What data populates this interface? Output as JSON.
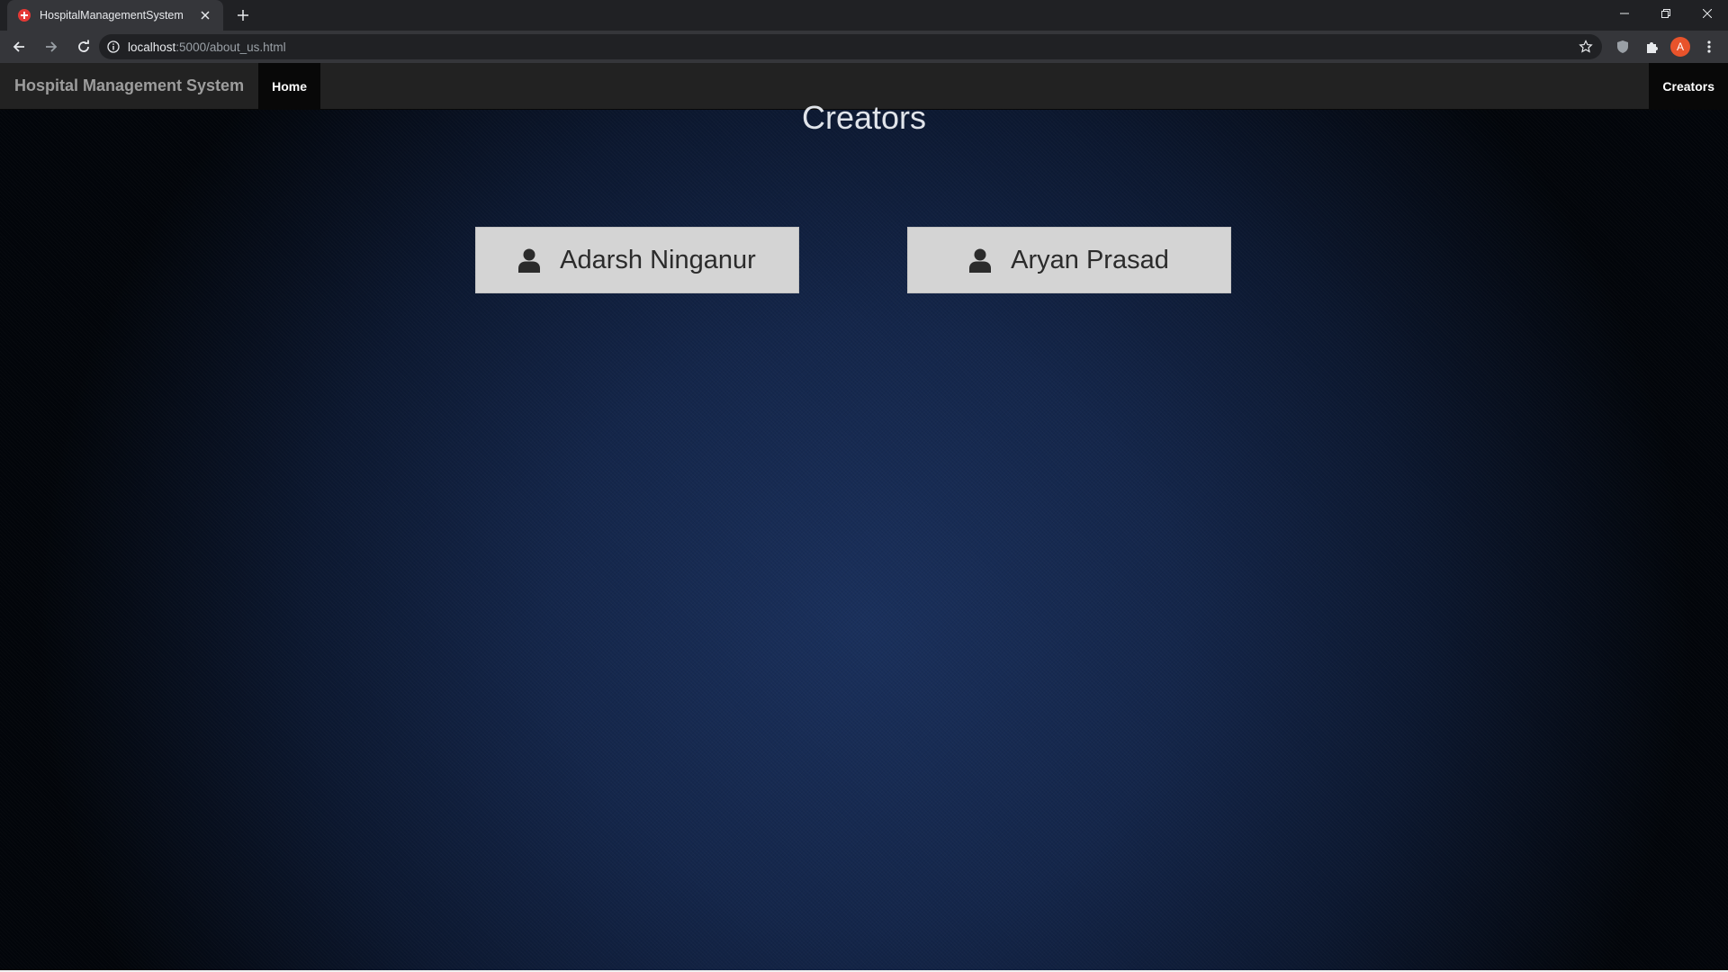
{
  "browser": {
    "tab": {
      "title": "HospitalManagementSystem",
      "favicon": "hospital-cross-icon"
    },
    "url": {
      "host": "localhost",
      "rest": ":5000/about_us.html"
    },
    "profile_initial": "A"
  },
  "navbar": {
    "brand": "Hospital Management System",
    "home": "Home",
    "creators": "Creators"
  },
  "main": {
    "title": "Creators",
    "creators": [
      {
        "name": "Adarsh Ninganur",
        "icon": "user-icon"
      },
      {
        "name": "Aryan Prasad",
        "icon": "user-icon"
      }
    ]
  },
  "colors": {
    "navbar_bg": "#222222",
    "brand_text": "#9d9d9d",
    "card_bg": "#d4d4d4",
    "page_bg": "#14264a"
  }
}
